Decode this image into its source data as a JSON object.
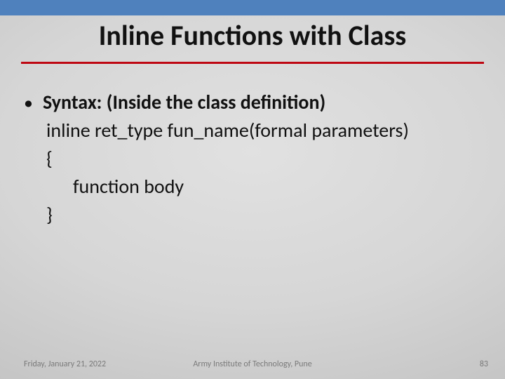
{
  "title": "Inline Functions with Class",
  "bullet": {
    "label": "Syntax: (Inside the class definition)",
    "lines": [
      "inline ret_type fun_name(formal parameters)",
      "{",
      "function body",
      "}"
    ]
  },
  "footer": {
    "date": "Friday, January 21, 2022",
    "org": "Army Institute of Technology, Pune",
    "page": "83"
  }
}
